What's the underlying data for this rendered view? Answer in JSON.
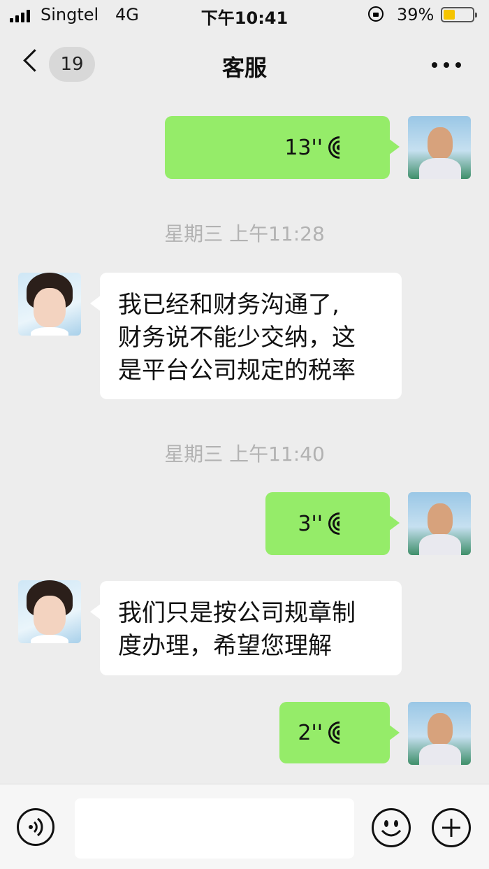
{
  "status_bar": {
    "carrier": "Singtel",
    "network": "4G",
    "time": "下午10:41",
    "battery_percent": "39%",
    "battery_level": 0.39,
    "battery_color": "#f5c400"
  },
  "nav": {
    "back_icon": "chevron-left",
    "unread_count": "19",
    "title": "客服",
    "more_icon": "ellipsis"
  },
  "messages": [
    {
      "type": "voice",
      "sender": "me",
      "duration": "13''"
    },
    {
      "type": "timestamp",
      "text": "星期三 上午11:28"
    },
    {
      "type": "text",
      "sender": "agent",
      "lines": [
        "我已经和财务沟通了,",
        "财务说不能少交纳，这",
        "是平台公司规定的税率"
      ]
    },
    {
      "type": "timestamp",
      "text": "星期三 上午11:40"
    },
    {
      "type": "voice",
      "sender": "me",
      "duration": "3''"
    },
    {
      "type": "text",
      "sender": "agent",
      "lines": [
        "我们只是按公司规章制",
        "度办理，希望您理解"
      ]
    },
    {
      "type": "voice",
      "sender": "me",
      "duration": "2''"
    }
  ],
  "colors": {
    "background": "#ededed",
    "my_bubble": "#95ec69",
    "agent_bubble": "#ffffff",
    "timestamp_text": "#b2b2b2"
  },
  "input_bar": {
    "voice_icon": "voice-toggle",
    "input_value": "",
    "emoji_icon": "smiley",
    "plus_icon": "plus"
  }
}
